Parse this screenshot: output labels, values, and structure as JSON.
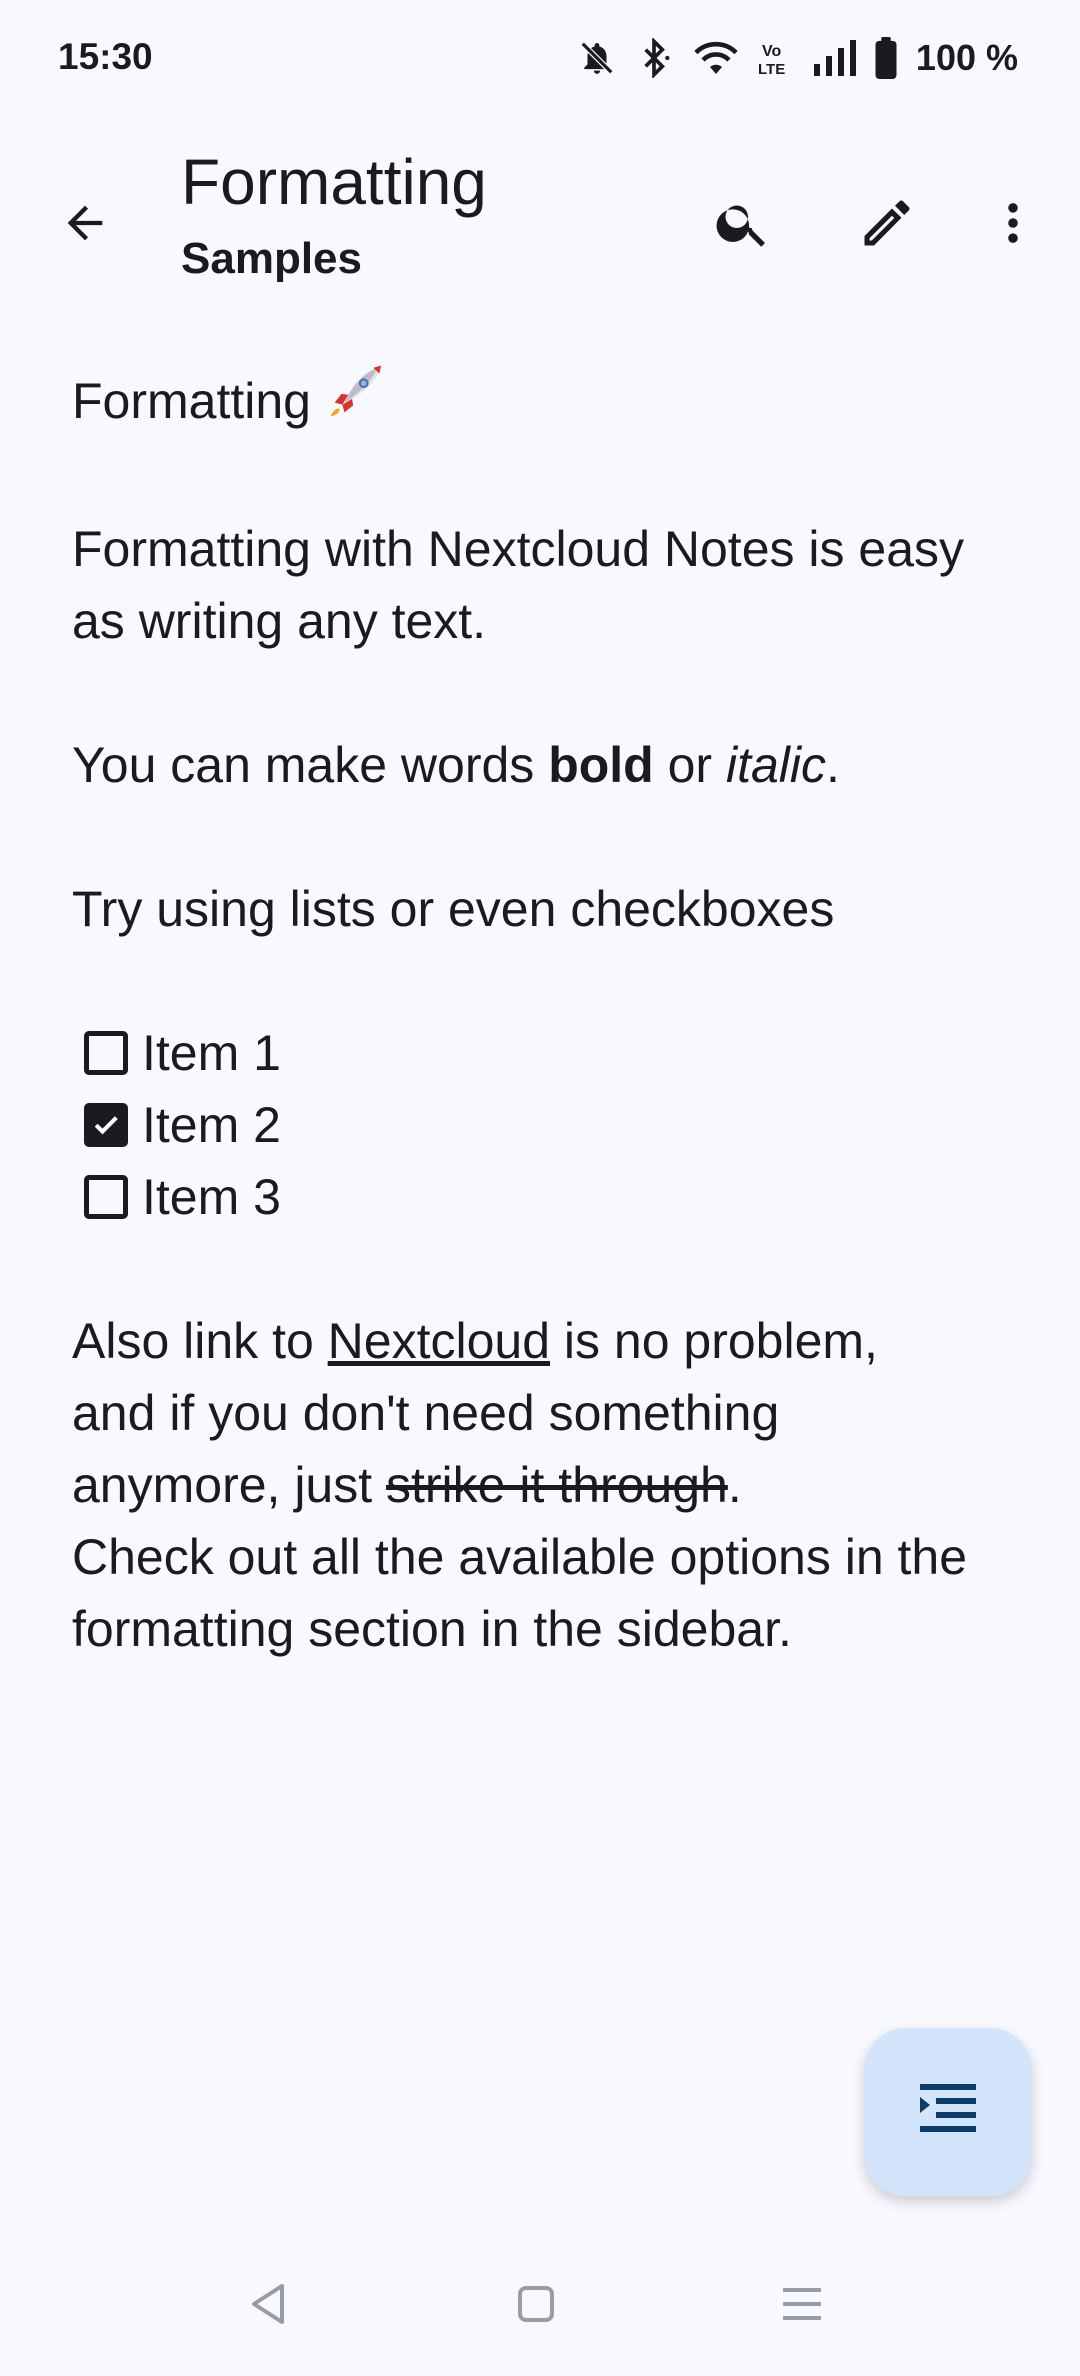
{
  "status_bar": {
    "time": "15:30",
    "battery": "100 %",
    "icons": [
      "bell-off-icon",
      "bluetooth-icon",
      "wifi-icon",
      "volte-icon",
      "signal-icon",
      "battery-icon"
    ]
  },
  "app_bar": {
    "title": "Formatting",
    "subtitle": "Samples",
    "actions": [
      "back-arrow-icon",
      "search-icon",
      "edit-pencil-icon",
      "more-vert-icon"
    ]
  },
  "note": {
    "heading": "Formatting",
    "heading_emoji": "rocket-icon",
    "intro": "Formatting with Nextcloud Notes is easy as writing any text.",
    "emphasis": {
      "pre": "You can make words ",
      "bold": "bold",
      "mid": " or ",
      "italic": "italic",
      "post": "."
    },
    "lists_line": "Try using lists or even checkboxes",
    "checklist": [
      {
        "label": "Item 1",
        "checked": false
      },
      {
        "label": "Item 2",
        "checked": true
      },
      {
        "label": "Item 3",
        "checked": false
      }
    ],
    "closing": {
      "pre_link": "Also link to ",
      "link": "Nextcloud",
      "post_link": " is no problem, and if you don't need something anymore, just ",
      "strike": "strike it through",
      "post_strike": ".",
      "last": "Check out all the available options in the formatting section in the sidebar."
    }
  },
  "fab": {
    "icon": "format-list-icon"
  },
  "nav_bar": {
    "buttons": [
      "nav-back-icon",
      "nav-home-icon",
      "nav-recents-icon"
    ]
  },
  "colors": {
    "background": "#f8f9ff",
    "text": "#1a1b20",
    "fab_background": "#d3e4fb",
    "fab_icon": "#0b3c6b"
  }
}
